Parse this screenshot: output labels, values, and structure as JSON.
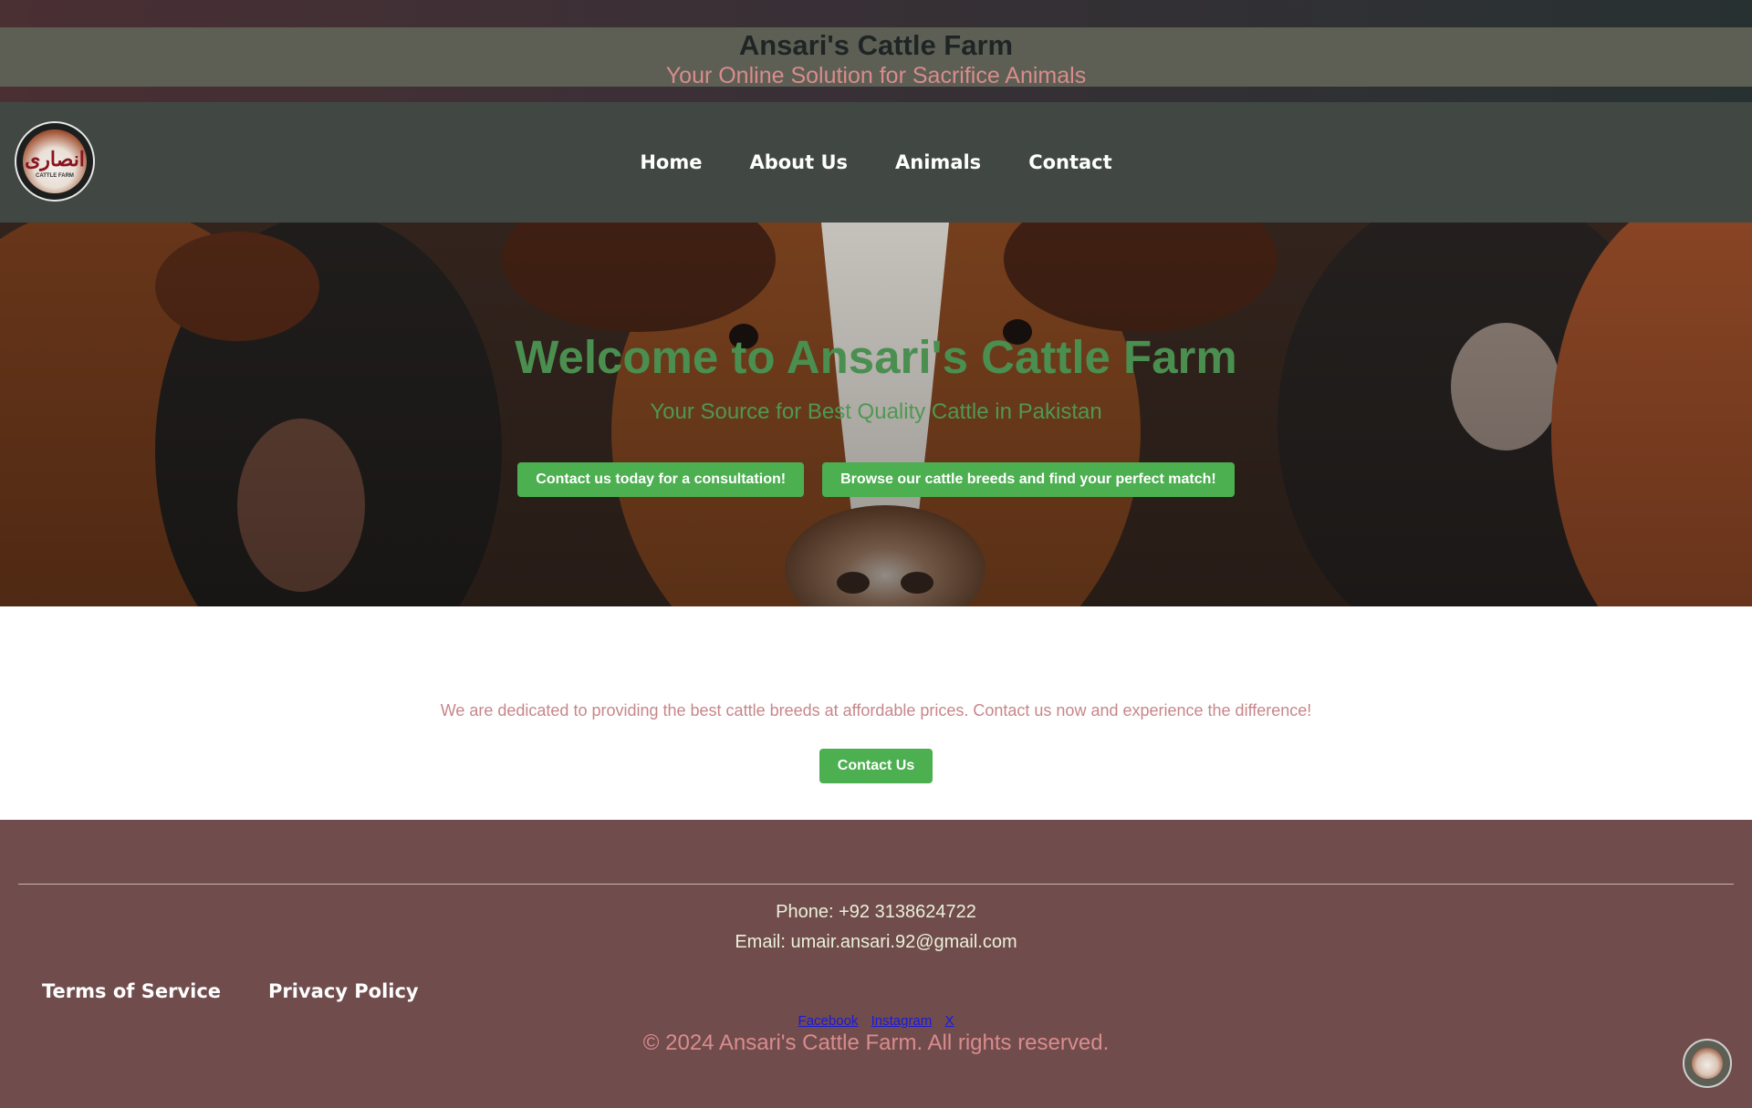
{
  "header": {
    "title": "Ansari's Cattle Farm",
    "tagline": "Your Online Solution for Sacrifice Animals"
  },
  "logo": {
    "icon": "farm-logo-icon",
    "glyph": "انصاری",
    "caption": "CATTLE FARM"
  },
  "nav": {
    "items": [
      {
        "label": "Home"
      },
      {
        "label": "About Us"
      },
      {
        "label": "Animals"
      },
      {
        "label": "Contact"
      }
    ]
  },
  "hero": {
    "title": "Welcome to Ansari's Cattle Farm",
    "subtitle": "Your Source for Best Quality Cattle in Pakistan",
    "buttons": [
      {
        "label": "Contact us today for a consultation!"
      },
      {
        "label": "Browse our cattle breeds and find your perfect match!"
      }
    ]
  },
  "intro": {
    "text": "We are dedicated to providing the best cattle breeds at affordable prices. Contact us now and experience the difference!",
    "button_label": "Contact Us"
  },
  "footer": {
    "phone": "Phone: +92 3138624722",
    "email": "Email: umair.ansari.92@gmail.com",
    "social_icons": [
      "",
      "",
      ""
    ],
    "legal_links": [
      {
        "label": "Terms of Service"
      },
      {
        "label": "Privacy Policy"
      }
    ],
    "social_links": [
      {
        "label": "Facebook"
      },
      {
        "label": "Instagram"
      },
      {
        "label": "X"
      }
    ],
    "copyright": "© 2024 Ansari's Cattle Farm. All rights reserved."
  },
  "colors": {
    "accent_green": "#4caf50",
    "nav_bg": "#414844",
    "footer_bg": "#714c4d",
    "tagline_pink": "#d88c8c"
  }
}
